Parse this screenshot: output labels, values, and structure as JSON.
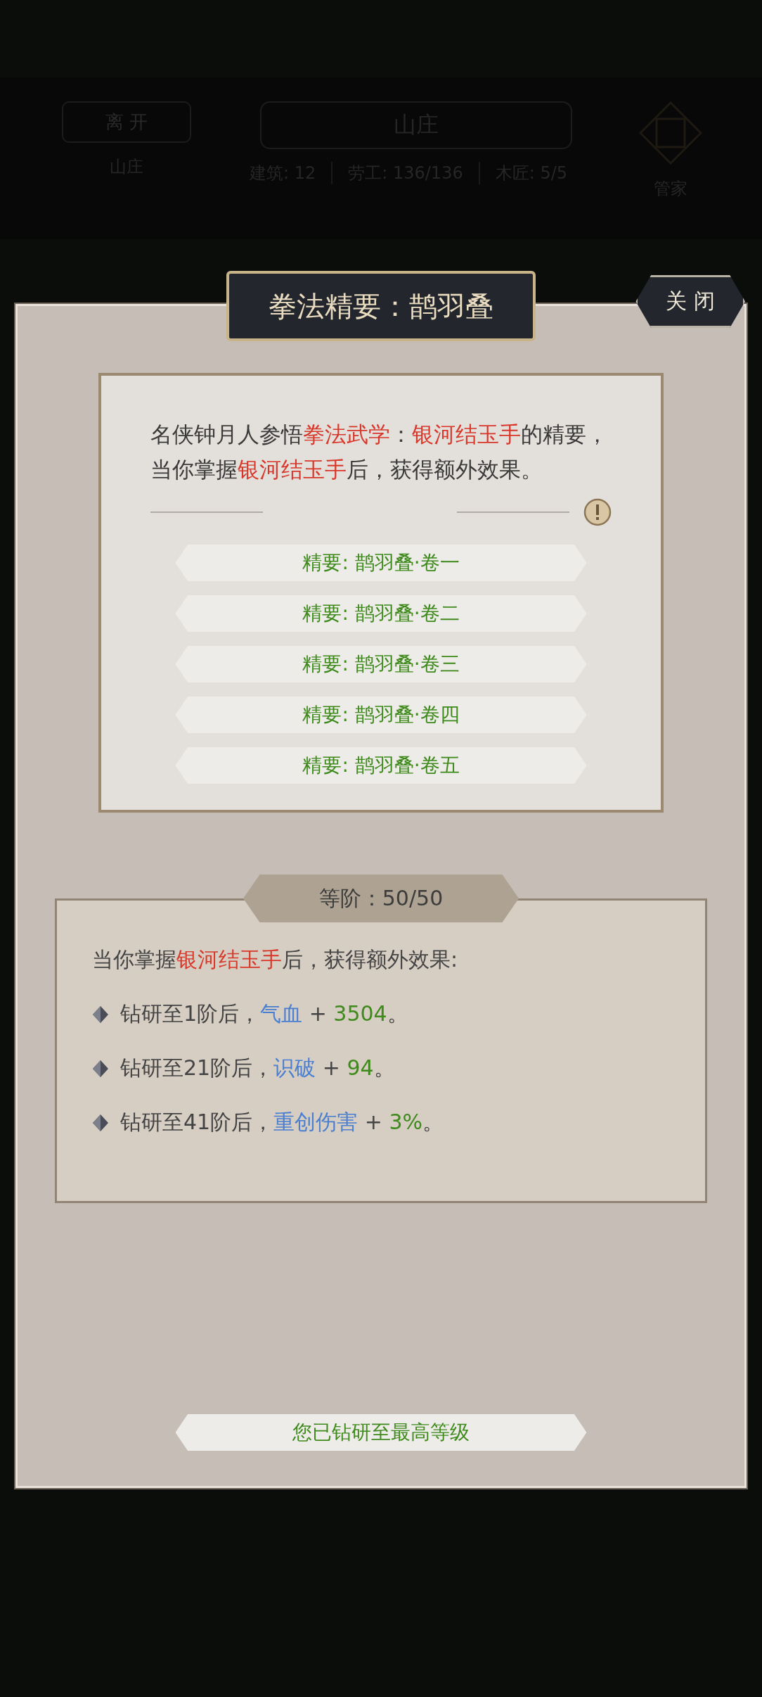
{
  "background": {
    "leave_button": "离 开",
    "location_title": "山庄",
    "location_label": "山庄",
    "stats": [
      {
        "label": "建筑:",
        "value": "12"
      },
      {
        "label": "劳工:",
        "value": "136/136"
      },
      {
        "label": "木匠:",
        "value": "5/5"
      }
    ],
    "steward_label": "管家"
  },
  "dialog": {
    "title": "拳法精要：鹊羽叠",
    "close_button": "关 闭",
    "intro": [
      {
        "kind": "plain",
        "text": "名侠钟月人参悟"
      },
      {
        "kind": "highlight",
        "text": "拳法武学"
      },
      {
        "kind": "plain",
        "text": "："
      },
      {
        "kind": "highlight",
        "text": "银河结玉手"
      },
      {
        "kind": "plain",
        "text": "的精要，当你掌握"
      },
      {
        "kind": "highlight",
        "text": "银河结玉手"
      },
      {
        "kind": "plain",
        "text": "后，获得额外效果。"
      }
    ],
    "volumes": [
      "精要: 鹊羽叠·卷一",
      "精要: 鹊羽叠·卷二",
      "精要: 鹊羽叠·卷三",
      "精要: 鹊羽叠·卷四",
      "精要: 鹊羽叠·卷五"
    ],
    "level_label": "等阶：50/50",
    "effects_intro": [
      {
        "kind": "plain",
        "text": "当你掌握"
      },
      {
        "kind": "highlight",
        "text": "银河结玉手"
      },
      {
        "kind": "plain",
        "text": "后，获得额外效果:"
      }
    ],
    "effects": [
      [
        {
          "kind": "plain",
          "text": "钻研至1阶后，"
        },
        {
          "kind": "attr",
          "text": "气血"
        },
        {
          "kind": "plain",
          "text": " + "
        },
        {
          "kind": "value",
          "text": "3504"
        },
        {
          "kind": "plain",
          "text": "。"
        }
      ],
      [
        {
          "kind": "plain",
          "text": "钻研至21阶后，"
        },
        {
          "kind": "attr",
          "text": "识破"
        },
        {
          "kind": "plain",
          "text": " + "
        },
        {
          "kind": "value",
          "text": "94"
        },
        {
          "kind": "plain",
          "text": "。"
        }
      ],
      [
        {
          "kind": "plain",
          "text": "钻研至41阶后，"
        },
        {
          "kind": "attr",
          "text": "重创伤害"
        },
        {
          "kind": "plain",
          "text": " + "
        },
        {
          "kind": "value",
          "text": "3%"
        },
        {
          "kind": "plain",
          "text": "。"
        }
      ]
    ],
    "status": "您已钻研至最高等级"
  }
}
